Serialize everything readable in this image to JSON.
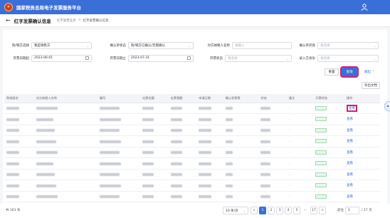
{
  "app": {
    "title": "国家税务总局电子发票服务平台",
    "emblem_glyph": "★",
    "user_icon": "user-icon"
  },
  "crumbbar": {
    "back_icon": "arrow-left-icon",
    "page_title": "红字发票确认信息",
    "crumbs": [
      "红字发票业务",
      "红字发票确认信息"
    ]
  },
  "filters": {
    "row1": [
      {
        "label": "购/销方选择",
        "value": "我是销售方",
        "placeholder": ""
      },
      {
        "label": "确认单状态",
        "value": "购/销方已确认/无需确认",
        "placeholder": ""
      },
      {
        "label": "对方纳税人名称",
        "value": "",
        "placeholder": "请输入"
      },
      {
        "label": "确认单开具",
        "value": "",
        "placeholder": "请选择"
      }
    ],
    "row2": [
      {
        "label": "开票日期起",
        "value": "2023-06-01",
        "placeholder": ""
      },
      {
        "label": "开票日期止",
        "value": "2023-07-31",
        "placeholder": ""
      },
      {
        "label": "开票状态",
        "value": "",
        "placeholder": "请选择"
      },
      {
        "label": "录入方身份",
        "value": "",
        "placeholder": "请选择"
      }
    ]
  },
  "buttons": {
    "reset": "重置",
    "query": "查询",
    "collapse": "收起",
    "export": "导出文档"
  },
  "table": {
    "columns": [
      "购销身份",
      "对方纳税人名称",
      "编号",
      "红票金额",
      "红票税额",
      "申请日期",
      "确认发票票",
      "状态",
      "备注",
      "开票状态",
      "操作"
    ],
    "op_label": "查看",
    "rows": [
      {
        "name_w": 30,
        "code_w": 28,
        "status_w": 14
      },
      {
        "name_w": 24,
        "code_w": 30,
        "status_w": 14
      },
      {
        "name_w": 26,
        "code_w": 28,
        "status_w": 14
      },
      {
        "name_w": 28,
        "code_w": 30,
        "status_w": 14
      },
      {
        "name_w": 30,
        "code_w": 28,
        "status_w": 14
      },
      {
        "name_w": 24,
        "code_w": 30,
        "status_w": 14
      },
      {
        "name_w": 26,
        "code_w": 28,
        "status_w": 14
      },
      {
        "name_w": 28,
        "code_w": 30,
        "status_w": 14
      },
      {
        "name_w": 30,
        "code_w": 28,
        "status_w": 14
      }
    ]
  },
  "pagination": {
    "total": "共 163 条",
    "page_size": "10 条/页",
    "pages": [
      "<",
      "1",
      "2",
      "3",
      "4",
      "5",
      "···",
      "17",
      ">"
    ],
    "current_page": "1",
    "goto_label": "前往",
    "goto_value": "1",
    "page_total": "/ 17 页"
  }
}
